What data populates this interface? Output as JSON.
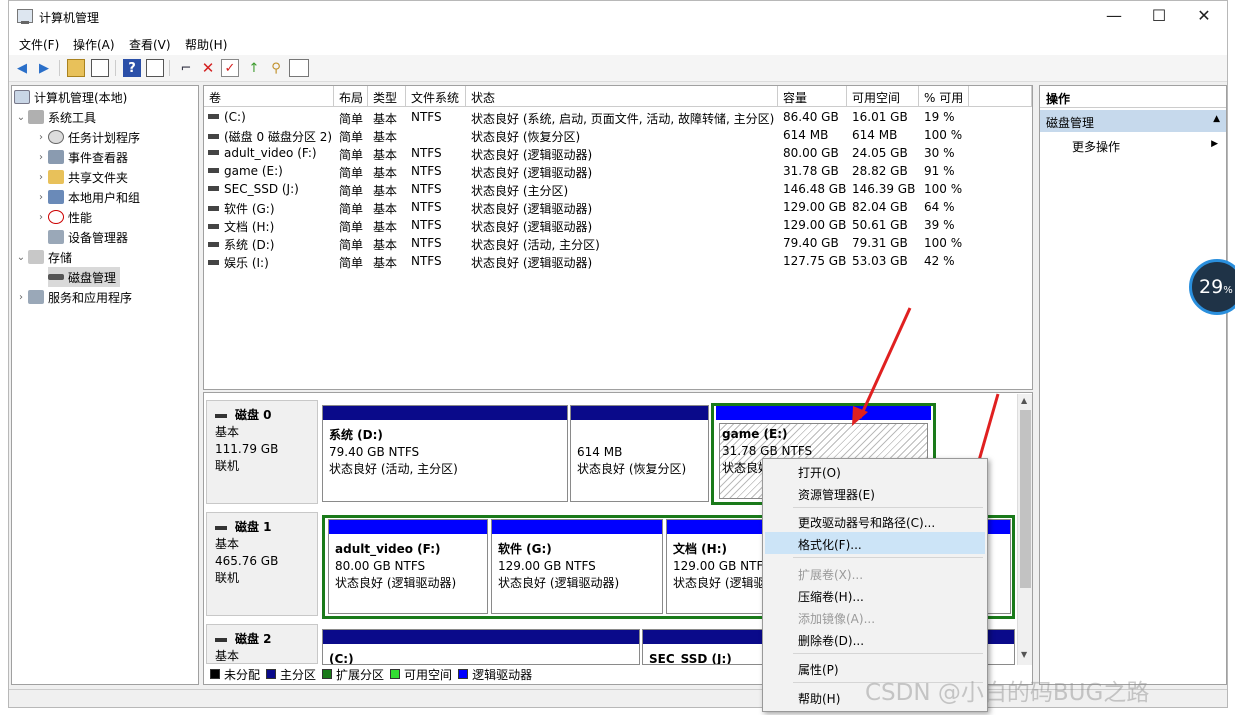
{
  "window": {
    "title": "计算机管理",
    "minimize_glyph": "—",
    "maximize_glyph": "☐",
    "close_glyph": "✕"
  },
  "menu": [
    "文件(F)",
    "操作(A)",
    "查看(V)",
    "帮助(H)"
  ],
  "toolbar": {
    "icons": [
      "back-icon",
      "forward-icon",
      "up-folder-icon",
      "show-tree-icon",
      "help-icon",
      "properties-icon",
      "connect-icon",
      "delete-icon",
      "check-icon",
      "import-icon",
      "search-icon",
      "console-icon"
    ]
  },
  "tree": {
    "root": "计算机管理(本地)",
    "system_tools": "系统工具",
    "task_scheduler": "任务计划程序",
    "event_viewer": "事件查看器",
    "shared_folders": "共享文件夹",
    "local_users": "本地用户和组",
    "performance": "性能",
    "device_manager": "设备管理器",
    "storage": "存储",
    "disk_management": "磁盘管理",
    "services_apps": "服务和应用程序"
  },
  "volume_table": {
    "headers": [
      "卷",
      "布局",
      "类型",
      "文件系统",
      "状态",
      "容量",
      "可用空间",
      "% 可用"
    ],
    "rows": [
      [
        "(C:)",
        "简单",
        "基本",
        "NTFS",
        "状态良好 (系统, 启动, 页面文件, 活动, 故障转储, 主分区)",
        "86.40 GB",
        "16.01 GB",
        "19 %"
      ],
      [
        "(磁盘 0 磁盘分区 2)",
        "简单",
        "基本",
        "",
        "状态良好 (恢复分区)",
        "614 MB",
        "614 MB",
        "100 %"
      ],
      [
        "adult_video (F:)",
        "简单",
        "基本",
        "NTFS",
        "状态良好 (逻辑驱动器)",
        "80.00 GB",
        "24.05 GB",
        "30 %"
      ],
      [
        "game (E:)",
        "简单",
        "基本",
        "NTFS",
        "状态良好 (逻辑驱动器)",
        "31.78 GB",
        "28.82 GB",
        "91 %"
      ],
      [
        "SEC_SSD (J:)",
        "简单",
        "基本",
        "NTFS",
        "状态良好 (主分区)",
        "146.48 GB",
        "146.39 GB",
        "100 %"
      ],
      [
        "软件 (G:)",
        "简单",
        "基本",
        "NTFS",
        "状态良好 (逻辑驱动器)",
        "129.00 GB",
        "82.04 GB",
        "64 %"
      ],
      [
        "文档 (H:)",
        "简单",
        "基本",
        "NTFS",
        "状态良好 (逻辑驱动器)",
        "129.00 GB",
        "50.61 GB",
        "39 %"
      ],
      [
        "系统 (D:)",
        "简单",
        "基本",
        "NTFS",
        "状态良好 (活动, 主分区)",
        "79.40 GB",
        "79.31 GB",
        "100 %"
      ],
      [
        "娱乐 (I:)",
        "简单",
        "基本",
        "NTFS",
        "状态良好 (逻辑驱动器)",
        "127.75 GB",
        "53.03 GB",
        "42 %"
      ]
    ]
  },
  "disks": [
    {
      "title": "磁盘 0",
      "type": "基本",
      "size": "111.79 GB",
      "status": "联机",
      "partitions": [
        {
          "name": "系统 (D:)",
          "size": "79.40 GB NTFS",
          "status": "状态良好 (活动, 主分区)"
        },
        {
          "name": "",
          "size": "614 MB",
          "status": "状态良好 (恢复分区)"
        },
        {
          "name": "game (E:)",
          "size": "31.78 GB NTFS",
          "status": "状态良好"
        }
      ]
    },
    {
      "title": "磁盘 1",
      "type": "基本",
      "size": "465.76 GB",
      "status": "联机",
      "partitions": [
        {
          "name": "adult_video (F:)",
          "size": "80.00 GB NTFS",
          "status": "状态良好 (逻辑驱动器)"
        },
        {
          "name": "软件 (G:)",
          "size": "129.00 GB NTFS",
          "status": "状态良好 (逻辑驱动器)"
        },
        {
          "name": "文档 (H:)",
          "size": "129.00 GB NTFS",
          "status": "状态良好 (逻辑驱"
        }
      ]
    },
    {
      "title": "磁盘 2",
      "type": "基本",
      "partitions": [
        {
          "name": "(C:)"
        },
        {
          "name": "SEC_SSD (J:)"
        }
      ]
    }
  ],
  "legend": [
    {
      "label": "未分配",
      "color": "#000000"
    },
    {
      "label": "主分区",
      "color": "#0a0a8a"
    },
    {
      "label": "扩展分区",
      "color": "#1a7a1a"
    },
    {
      "label": "可用空间",
      "color": "#33dd33"
    },
    {
      "label": "逻辑驱动器",
      "color": "#0000ff"
    }
  ],
  "actions": {
    "header": "操作",
    "section": "磁盘管理",
    "more": "更多操作"
  },
  "context_menu": {
    "open": "打开(O)",
    "explore": "资源管理器(E)",
    "change_letter": "更改驱动器号和路径(C)...",
    "format": "格式化(F)...",
    "extend": "扩展卷(X)...",
    "shrink": "压缩卷(H)...",
    "add_mirror": "添加镜像(A)...",
    "delete": "删除卷(D)...",
    "properties": "属性(P)",
    "help": "帮助(H)"
  },
  "overlay": {
    "percent": "29",
    "percent_unit": "%",
    "watermark": "CSDN @小白的码BUG之路"
  }
}
